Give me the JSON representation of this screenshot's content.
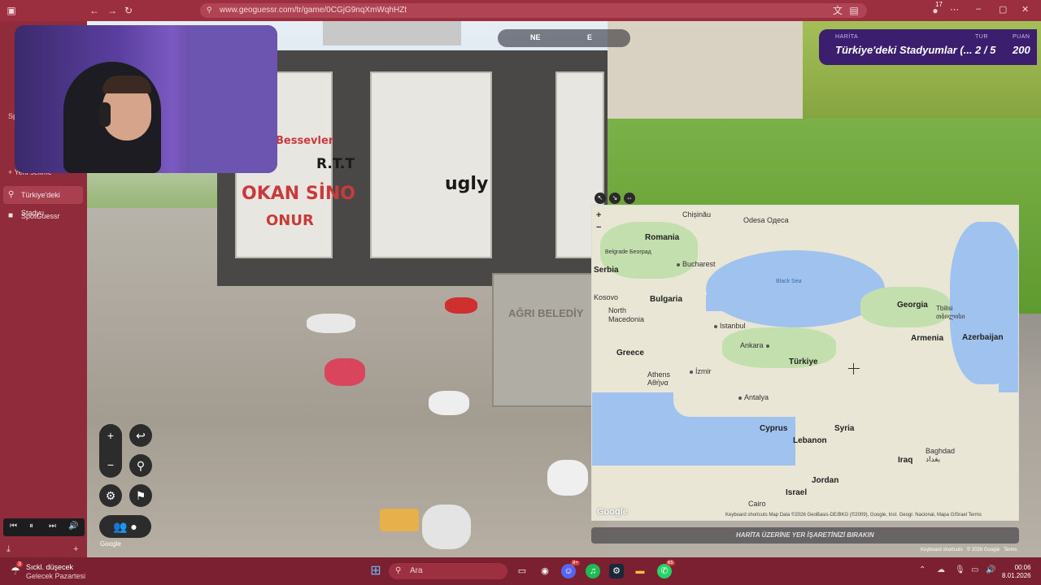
{
  "browser": {
    "url": "www.geoguessr.com/tr/game/0CGjG9nqXmWqhHZt",
    "notification_count": "17"
  },
  "sidebar": {
    "section_label": "Sp",
    "new_tab_label": "Yeni sekme",
    "items": [
      {
        "label": "Türkiye'deki Stadyu",
        "icon": "map-pin-icon"
      },
      {
        "label": "SpotGuessr",
        "icon": "spotguessr-icon"
      }
    ]
  },
  "game": {
    "compass": {
      "ne": "NE",
      "e": "E"
    },
    "score": {
      "map_key": "HARİTA",
      "map_value": "Türkiye'deki Stadyumlar (...",
      "round_key": "TUR",
      "round_value": "2 / 5",
      "points_key": "PUAN",
      "points_value": "200"
    },
    "bin_label": "AĞRI BELEDİY",
    "graffiti": [
      "Bessevler",
      "OKAN SİNO",
      "ONUR",
      "R.T.T",
      "ugly"
    ],
    "place_hint": "HARİTA ÜZERİNE YER İŞARETİNİZİ BIRAKIN",
    "keyboard_shortcuts": "Keyboard shortcuts",
    "copyright": "© 2026 Google",
    "terms": "Terms",
    "google": "Google"
  },
  "map": {
    "labels": {
      "chisinau": "Chișinău",
      "odesa": "Odesa\nОдеса",
      "romania": "Romania",
      "belgrade": "Belgrade\nБеоград",
      "bucharest": "Bucharest",
      "serbia": "Serbia",
      "black_sea": "Black Sea",
      "kosovo": "Kosovo",
      "bulgaria": "Bulgaria",
      "north_macedonia": "North\nMacedonia",
      "georgia": "Georgia",
      "tbilisi": "Tbilisi\nთბილისი",
      "istanbul": "Istanbul",
      "armenia": "Armenia",
      "azerbaijan": "Azerbaijan",
      "ankara": "Ankara",
      "greece": "Greece",
      "turkiye": "Türkiye",
      "athens": "Athens\nΑθήνα",
      "izmir": "İzmir",
      "antalya": "Antalya",
      "cyprus": "Cyprus",
      "syria": "Syria",
      "lebanon": "Lebanon",
      "baghdad": "Baghdad\nبغداد",
      "iraq": "Iraq",
      "jordan": "Jordan",
      "israel": "Israel",
      "cairo": "Cairo"
    },
    "attribution": "Keyboard shortcuts   Map Data ©2026 GeoBasis-DE/BKG (©2009), Google, Inst. Geogr. Nacional, Mapa GISrael   Terms",
    "google": "Google"
  },
  "taskbar": {
    "weather_title": "Sıckl. düşecek",
    "weather_sub": "Gelecek Pazartesi",
    "weather_badge": "3",
    "search_placeholder": "Ara",
    "time": "00:06",
    "date": "8.01.2026",
    "discord_badge": "9+",
    "whatsapp_badge": "65"
  }
}
